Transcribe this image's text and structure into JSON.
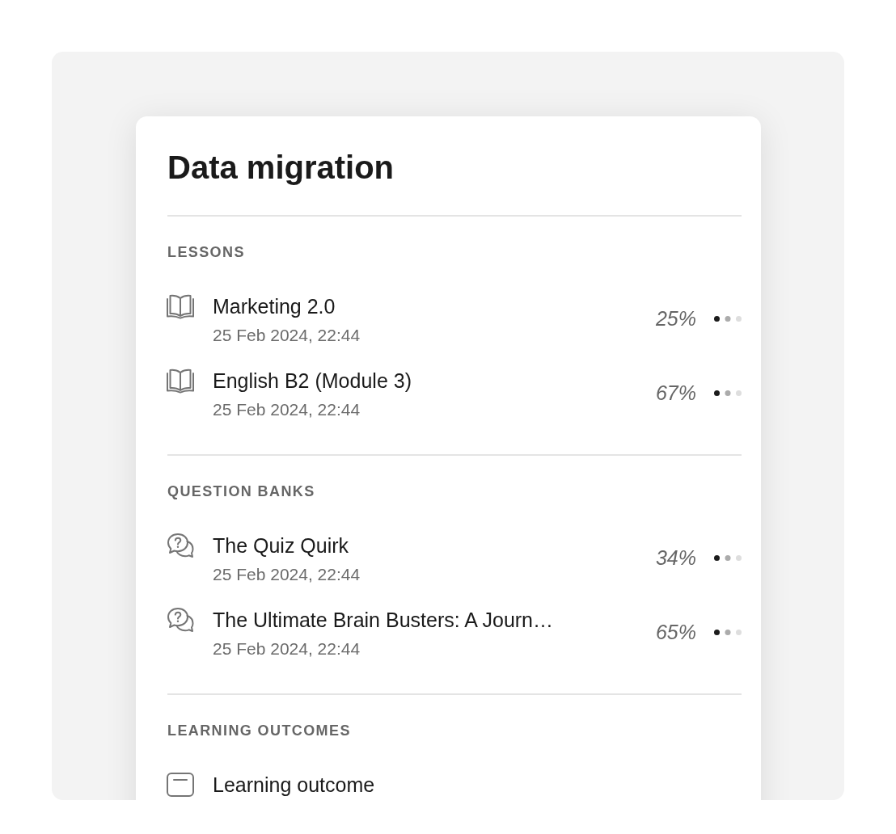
{
  "title": "Data migration",
  "sections": [
    {
      "heading": "LESSONS",
      "items": [
        {
          "kind": "lesson",
          "name": "Marketing 2.0",
          "date": "25 Feb 2024, 22:44",
          "progress": "25%"
        },
        {
          "kind": "lesson",
          "name": "English B2 (Module 3)",
          "date": "25 Feb 2024, 22:44",
          "progress": "67%"
        }
      ]
    },
    {
      "heading": "QUESTION BANKS",
      "items": [
        {
          "kind": "question_bank",
          "name": "The Quiz Quirk",
          "date": "25 Feb 2024, 22:44",
          "progress": "34%"
        },
        {
          "kind": "question_bank",
          "name": "The Ultimate Brain Busters: A Journ…",
          "date": "25 Feb 2024, 22:44",
          "progress": "65%"
        }
      ]
    },
    {
      "heading": "LEARNING OUTCOMES",
      "items": [
        {
          "kind": "outcome",
          "name": "Learning outcome"
        }
      ]
    }
  ]
}
